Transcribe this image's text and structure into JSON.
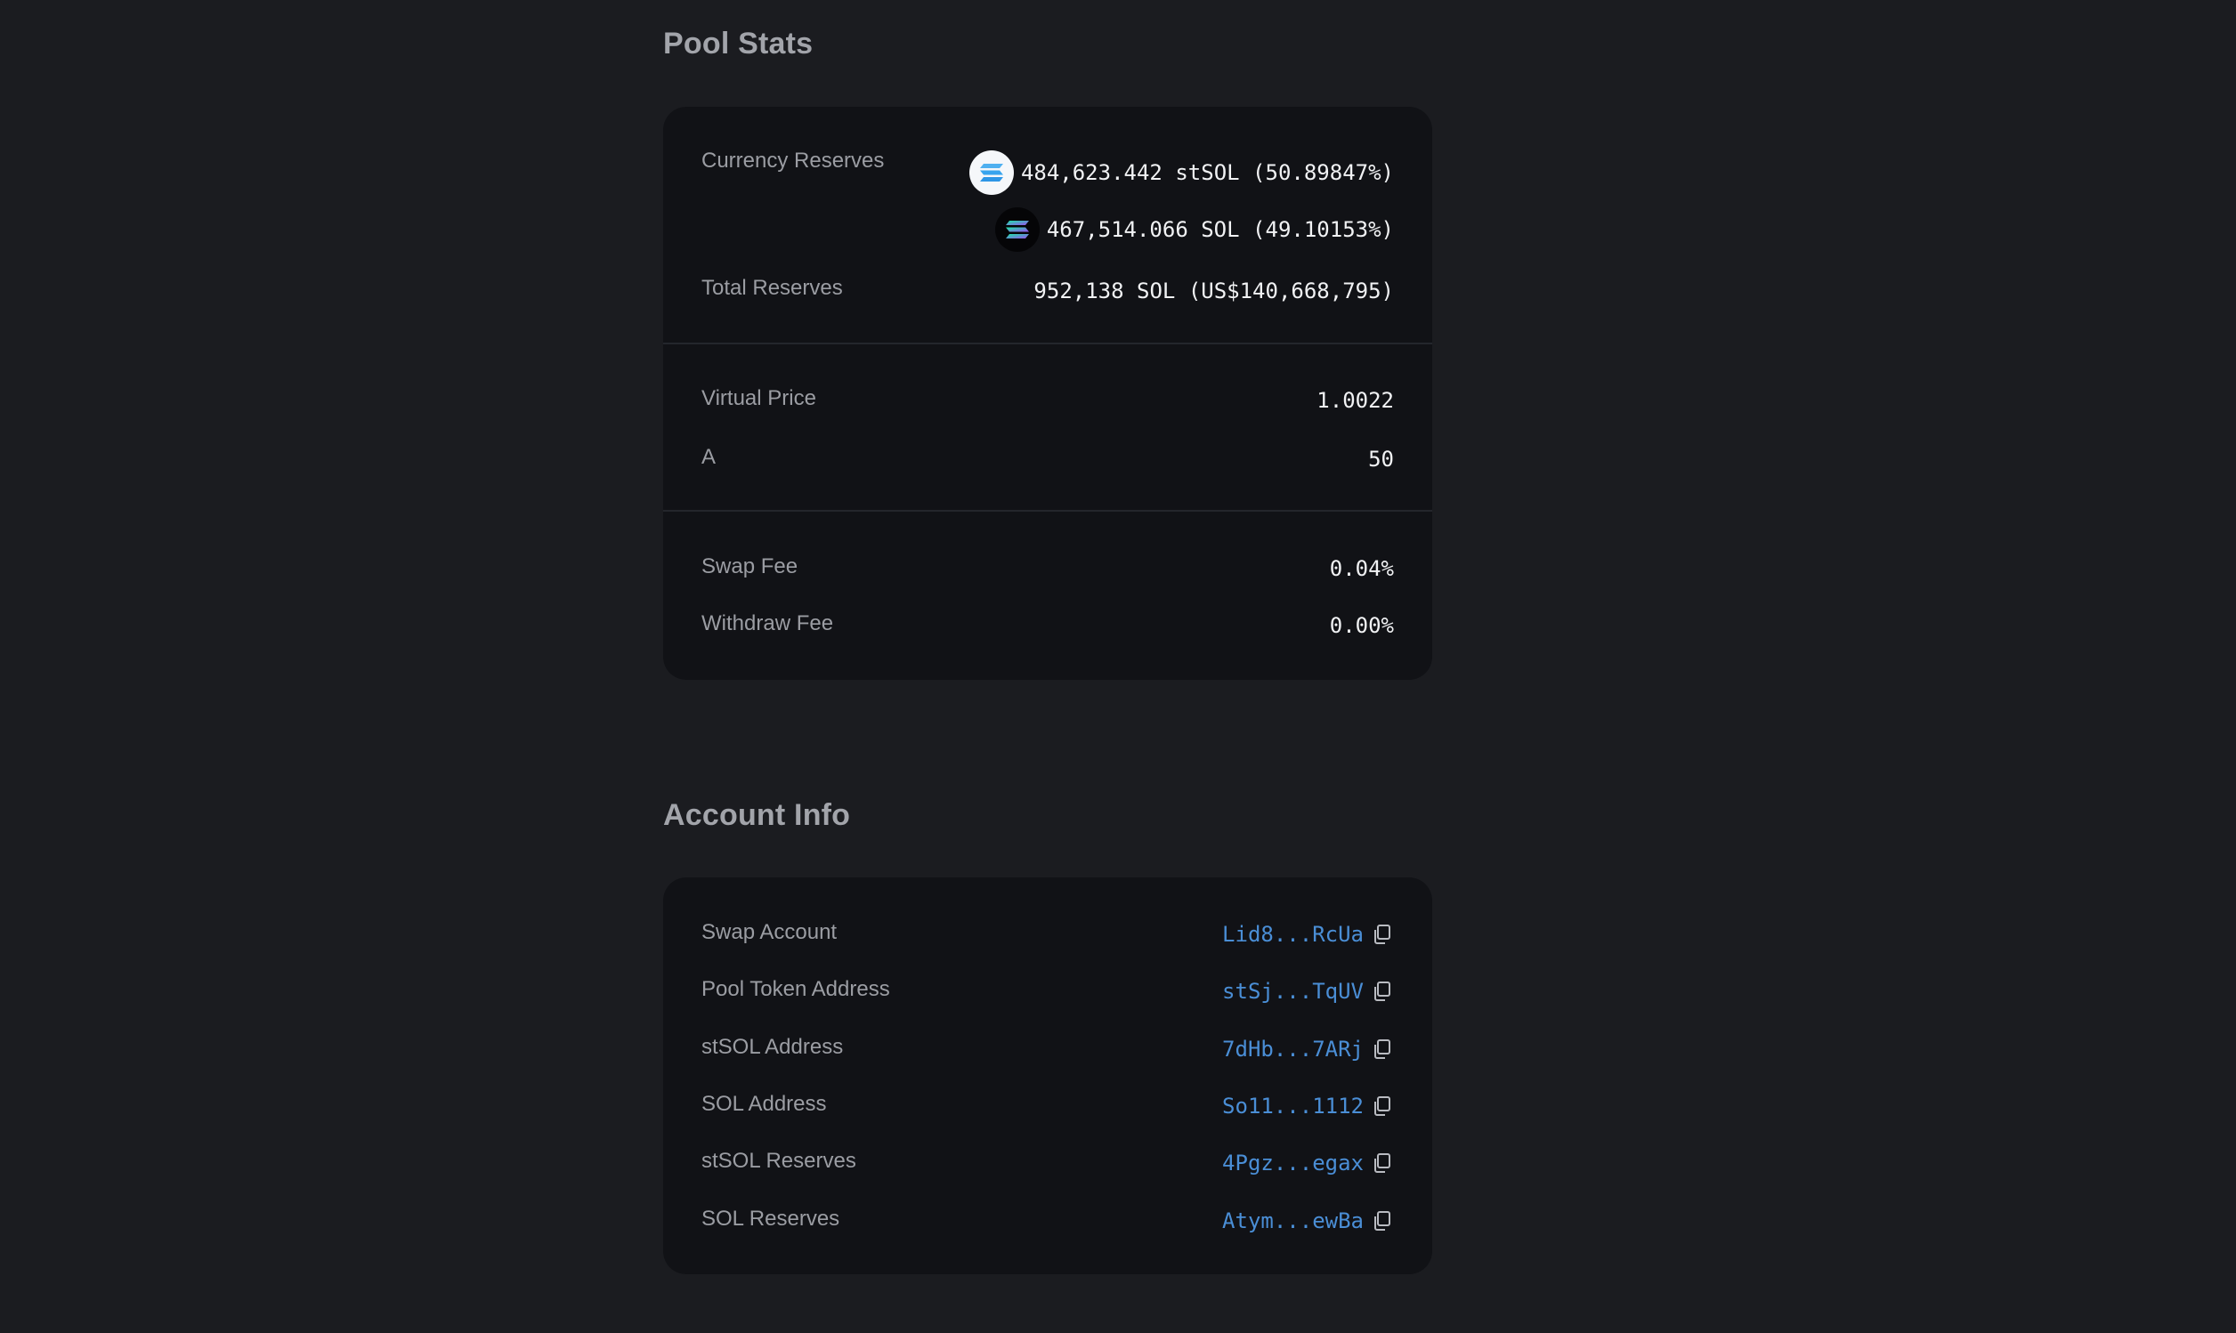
{
  "pool_stats": {
    "title": "Pool Stats",
    "currency_reserves_label": "Currency Reserves",
    "reserves": [
      {
        "amount": "484,623.442",
        "symbol": "stSOL",
        "percent": "(50.89847%)",
        "icon": "stsol-token-icon"
      },
      {
        "amount": "467,514.066",
        "symbol": "SOL",
        "percent": "(49.10153%)",
        "icon": "sol-token-icon"
      }
    ],
    "total_reserves_label": "Total Reserves",
    "total_reserves_value": "952,138 SOL (US$140,668,795)",
    "virtual_price_label": "Virtual Price",
    "virtual_price_value": "1.0022",
    "a_label": "A",
    "a_value": "50",
    "swap_fee_label": "Swap Fee",
    "swap_fee_value": "0.04%",
    "withdraw_fee_label": "Withdraw Fee",
    "withdraw_fee_value": "0.00%"
  },
  "account_info": {
    "title": "Account Info",
    "rows": [
      {
        "label": "Swap Account",
        "address": "Lid8...RcUa"
      },
      {
        "label": "Pool Token Address",
        "address": "stSj...TqUV"
      },
      {
        "label": "stSOL Address",
        "address": "7dHb...7ARj"
      },
      {
        "label": "SOL Address",
        "address": "So11...1112"
      },
      {
        "label": "stSOL Reserves",
        "address": "4Pgz...egax"
      },
      {
        "label": "SOL Reserves",
        "address": "Atym...ewBa"
      }
    ]
  },
  "colors": {
    "background": "#1b1c20",
    "card": "#111216",
    "link": "#4a8ed6",
    "label": "#9b9da3",
    "value": "#f1f2f4"
  }
}
